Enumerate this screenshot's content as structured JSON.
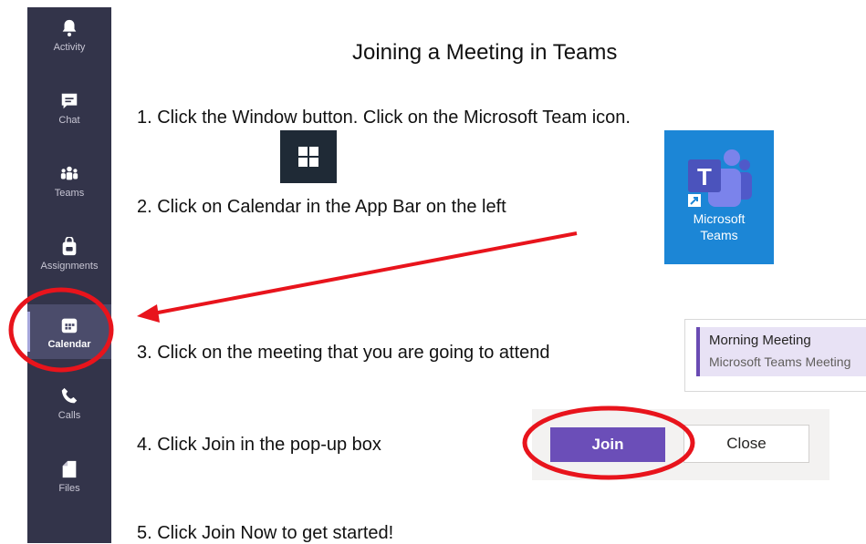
{
  "appbar": {
    "items": [
      {
        "label": "Activity",
        "icon": "bell-icon"
      },
      {
        "label": "Chat",
        "icon": "chat-icon"
      },
      {
        "label": "Teams",
        "icon": "teams-icon"
      },
      {
        "label": "Assignments",
        "icon": "assignments-icon"
      },
      {
        "label": "Calendar",
        "icon": "calendar-icon",
        "selected": true
      },
      {
        "label": "Calls",
        "icon": "phone-icon"
      },
      {
        "label": "Files",
        "icon": "file-icon"
      }
    ]
  },
  "document": {
    "title": "Joining a Meeting in Teams",
    "steps": [
      "1. Click the Window button. Click on the Microsoft Team icon.",
      "2. Click on Calendar in the App Bar on the left",
      "3. Click on the meeting that you are going to attend",
      "4. Click Join in the pop-up box",
      "5. Click Join Now to get started!"
    ]
  },
  "teams_tile": {
    "label_line1": "Microsoft",
    "label_line2": "Teams"
  },
  "meeting": {
    "title": "Morning Meeting",
    "subtitle": "Microsoft Teams Meeting"
  },
  "join_popup": {
    "join_label": "Join",
    "close_label": "Close"
  },
  "colors": {
    "appbar_bg": "#33344a",
    "teams_purple": "#6b4eb8",
    "annotation_red": "#e8141c",
    "teams_tile_blue": "#1c86d6"
  }
}
